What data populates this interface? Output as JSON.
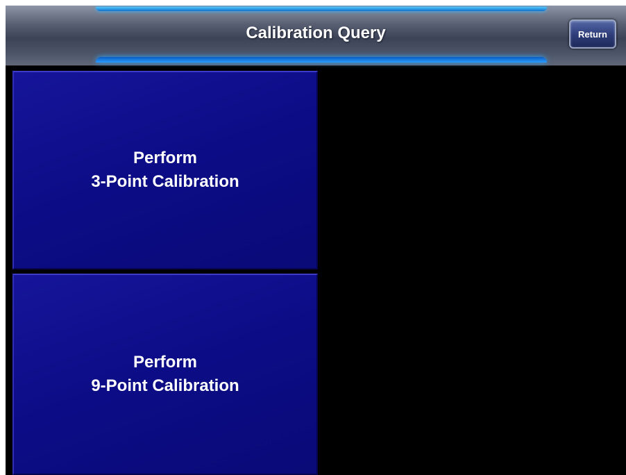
{
  "header": {
    "title": "Calibration Query",
    "return_label": "Return"
  },
  "buttons": [
    {
      "line1": "Perform",
      "line2": "3-Point Calibration"
    },
    {
      "line1": "Perform",
      "line2": "9-Point Calibration"
    }
  ],
  "colors": {
    "background": "#000000",
    "button_blue": "#0c0c86",
    "glow_blue": "#2ea6ff",
    "header_gray": "#4c5468"
  }
}
